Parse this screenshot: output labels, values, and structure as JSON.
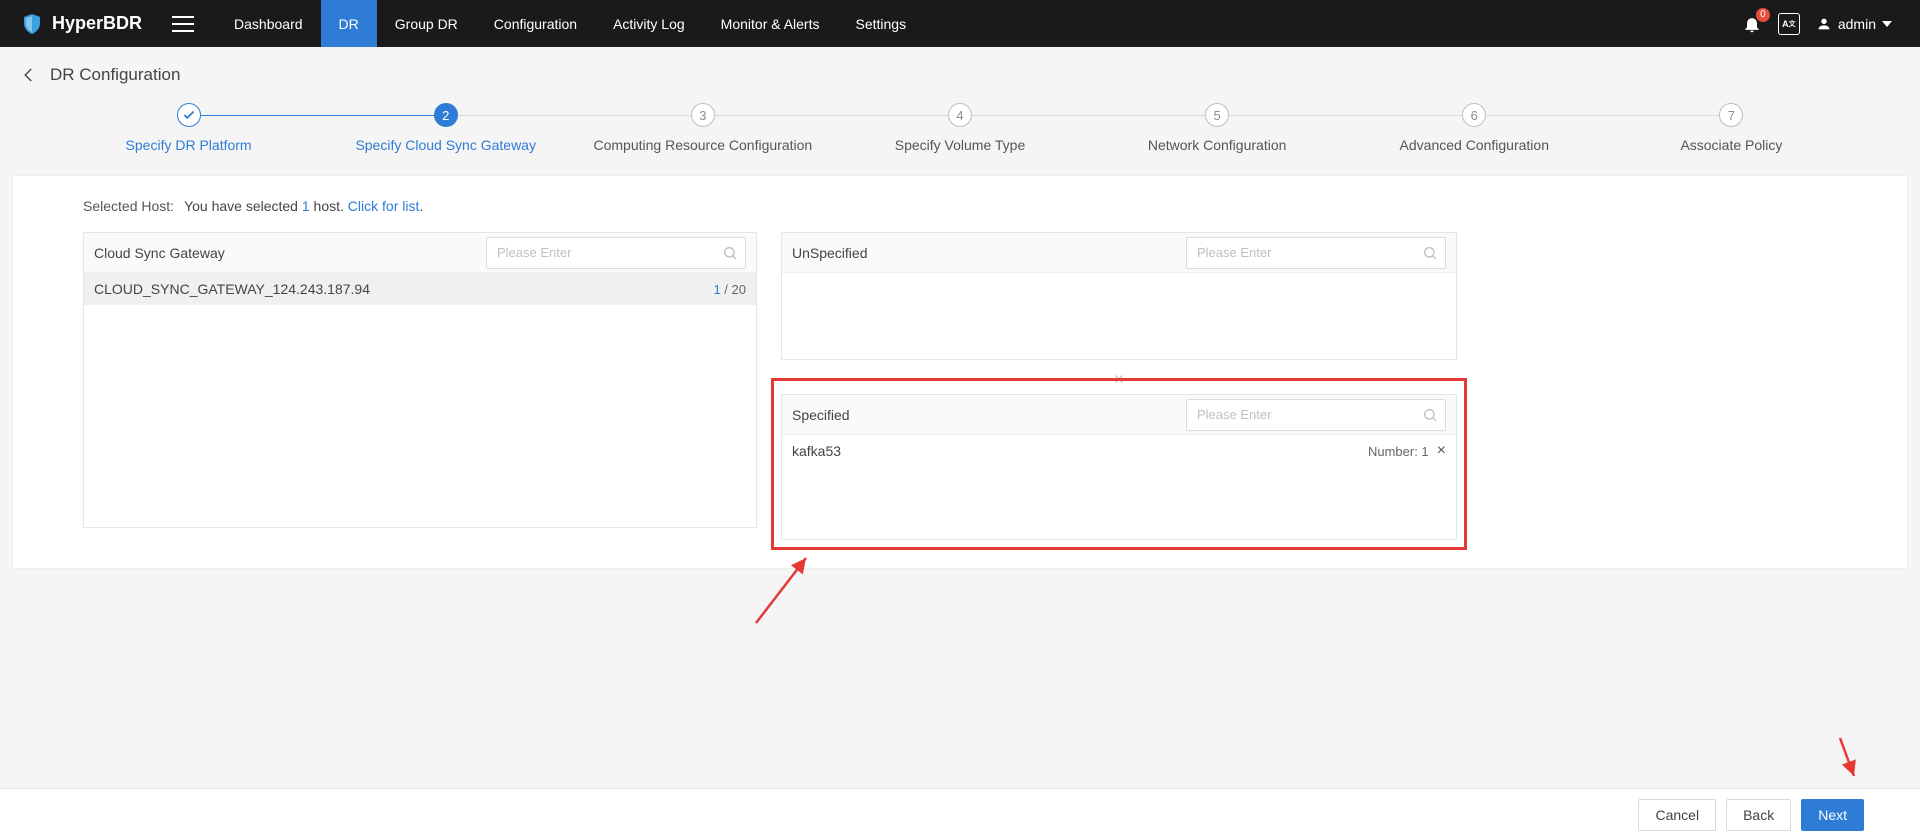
{
  "brand": "HyperBDR",
  "nav": {
    "items": [
      "Dashboard",
      "DR",
      "Group DR",
      "Configuration",
      "Activity Log",
      "Monitor & Alerts",
      "Settings"
    ],
    "active_index": 1
  },
  "topRight": {
    "notification_count": "0",
    "lang": "A",
    "user": "admin"
  },
  "pageTitle": "DR Configuration",
  "steps": [
    {
      "label": "Specify DR Platform",
      "state": "done",
      "num": "✓"
    },
    {
      "label": "Specify Cloud Sync Gateway",
      "state": "active",
      "num": "2"
    },
    {
      "label": "Computing Resource Configuration",
      "state": "",
      "num": "3"
    },
    {
      "label": "Specify Volume Type",
      "state": "",
      "num": "4"
    },
    {
      "label": "Network Configuration",
      "state": "",
      "num": "5"
    },
    {
      "label": "Advanced Configuration",
      "state": "",
      "num": "6"
    },
    {
      "label": "Associate Policy",
      "state": "",
      "num": "7"
    }
  ],
  "selectedHost": {
    "label": "Selected Host:",
    "prefix": "You have selected ",
    "count": "1",
    "mid": " host. ",
    "link": "Click for list",
    "suffix": "."
  },
  "leftPanel": {
    "title": "Cloud Sync Gateway",
    "search_placeholder": "Please Enter",
    "row_name": "CLOUD_SYNC_GATEWAY_124.243.187.94",
    "row_used": "1",
    "row_sep": " / ",
    "row_cap": "20"
  },
  "unspecPanel": {
    "title": "UnSpecified",
    "search_placeholder": "Please Enter"
  },
  "specPanel": {
    "title": "Specified",
    "search_placeholder": "Please Enter",
    "row_name": "kafka53",
    "row_number_label": "Number: ",
    "row_number_value": "1"
  },
  "footer": {
    "cancel": "Cancel",
    "back": "Back",
    "next": "Next"
  }
}
